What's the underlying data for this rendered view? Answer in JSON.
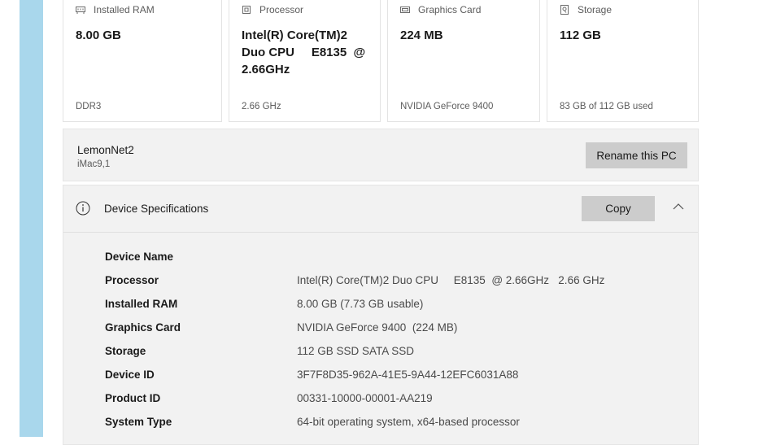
{
  "colors": {
    "accent_strip": "#a9d7ec",
    "panel_bg": "#f2f2f2",
    "button_bg": "#cccccc"
  },
  "cards": [
    {
      "icon": "ram-icon",
      "title": "Installed RAM",
      "value": "8.00 GB",
      "footer": "DDR3"
    },
    {
      "icon": "processor-icon",
      "title": "Processor",
      "value": "Intel(R) Core(TM)2\nDuo CPU     E8135  @\n2.66GHz",
      "footer": "2.66 GHz"
    },
    {
      "icon": "graphics-card-icon",
      "title": "Graphics Card",
      "value": "224 MB",
      "footer": "NVIDIA GeForce 9400"
    },
    {
      "icon": "storage-icon",
      "title": "Storage",
      "value": "112 GB",
      "footer": "83 GB of 112 GB used"
    }
  ],
  "pc": {
    "name": "LemonNet2",
    "model": "iMac9,1",
    "rename_label": "Rename this PC"
  },
  "specs": {
    "title": "Device Specifications",
    "copy_label": "Copy",
    "rows": [
      {
        "label": "Device Name",
        "value": ""
      },
      {
        "label": "Processor",
        "value": "Intel(R) Core(TM)2 Duo CPU     E8135  @ 2.66GHz   2.66 GHz"
      },
      {
        "label": "Installed RAM",
        "value": "8.00 GB (7.73 GB usable)"
      },
      {
        "label": "Graphics Card",
        "value": "NVIDIA GeForce 9400  (224 MB)"
      },
      {
        "label": "Storage",
        "value": "112 GB SSD SATA SSD"
      },
      {
        "label": "Device ID",
        "value": "3F7F8D35-962A-41E5-9A44-12EFC6031A88"
      },
      {
        "label": "Product ID",
        "value": "00331-10000-00001-AA219"
      },
      {
        "label": "System Type",
        "value": "64-bit operating system, x64-based processor"
      }
    ]
  }
}
